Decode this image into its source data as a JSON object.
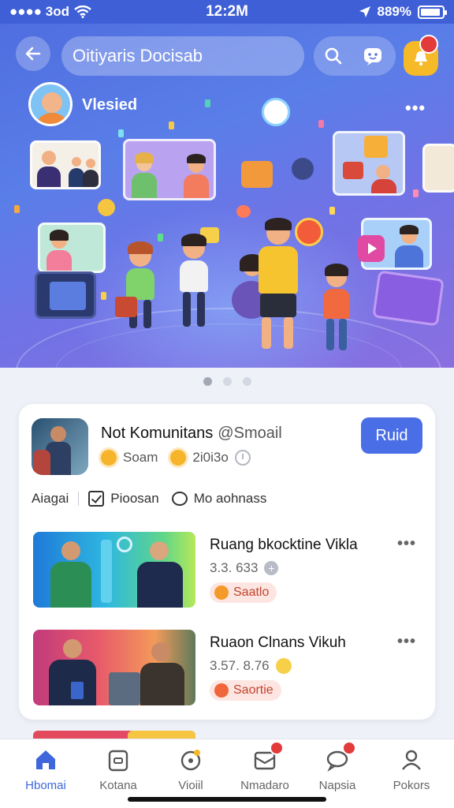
{
  "status_bar": {
    "carrier": "●●●● 3od",
    "time": "12:2M",
    "battery": "889%"
  },
  "header": {
    "search_text": "Oitiyaris Docisab",
    "profile_label": "Vlesied"
  },
  "icons": {
    "back": "arrow-left-icon",
    "search": "search-icon",
    "chat": "chat-face-icon",
    "notification": "bell-icon",
    "more": "more-icon"
  },
  "colors": {
    "accent": "#4a6ee6",
    "hero_start": "#4f6ee0",
    "hero_end": "#8a6fe0",
    "badge": "#e33a3a",
    "tag_bg": "#fde6e2",
    "tag_text": "#c2432c"
  },
  "carousel": {
    "page_count": 3,
    "active_index": 0
  },
  "community": {
    "title": "Not Komunitans",
    "handle": "@Smoail",
    "meta_1": "Soam",
    "meta_2": "2i0i3o",
    "join_label": "Ruid",
    "actions": [
      "Aiagai",
      "Pioosan",
      "Mo aohnass"
    ]
  },
  "rooms": [
    {
      "name": "Ruang bkocktine Vikla",
      "meta": "3.3. 633",
      "tag": "Saatlo"
    },
    {
      "name": "Ruaon Clnans Vikuh",
      "meta": "3.57. 8.76",
      "tag": "Saortie"
    }
  ],
  "bottom_nav": [
    {
      "label": "Hbomai",
      "icon": "home-icon",
      "active": true
    },
    {
      "label": "Kotana",
      "icon": "clipboard-icon",
      "active": false
    },
    {
      "label": "Vioiil",
      "icon": "explore-icon",
      "active": false
    },
    {
      "label": "Nmadaro",
      "icon": "inbox-icon",
      "active": false,
      "badge": true
    },
    {
      "label": "Napsia",
      "icon": "message-icon",
      "active": false,
      "badge": true
    },
    {
      "label": "Pokors",
      "icon": "profile-icon",
      "active": false
    }
  ]
}
